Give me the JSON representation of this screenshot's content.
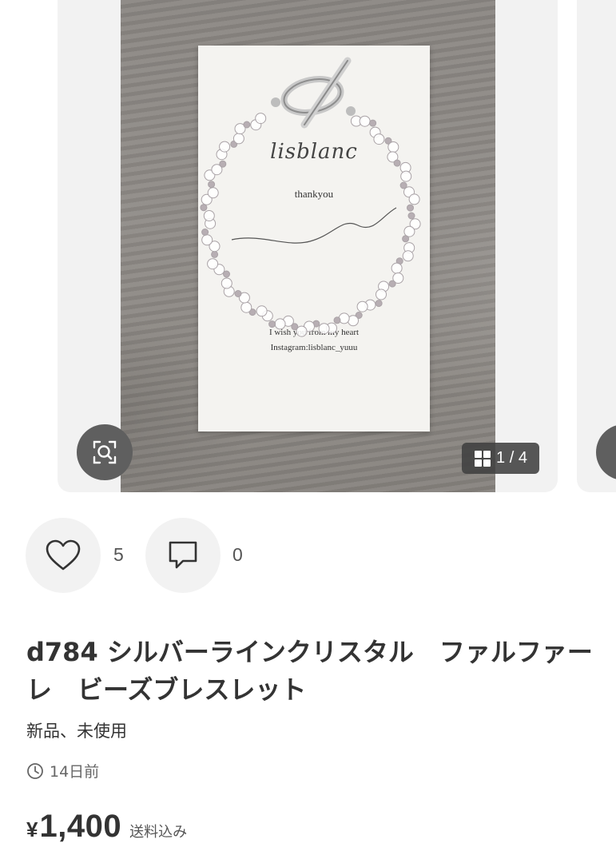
{
  "carousel": {
    "photo": {
      "card_brand": "lisblanc",
      "card_thankyou": "thankyou",
      "card_message": "I wish you     from my heart",
      "card_instagram": "Instagram:lisblanc_yuuu"
    },
    "zoom_icon": "zoom-search-icon",
    "counter": {
      "icon": "grid-icon",
      "text": "1 / 4"
    }
  },
  "actions": {
    "like": {
      "icon": "heart-icon",
      "count": "5"
    },
    "comment": {
      "icon": "comment-icon",
      "count": "0"
    }
  },
  "item": {
    "title": "d784 シルバーラインクリスタル　ファルファーレ　ビーズブレスレット",
    "condition": "新品、未使用",
    "posted_icon": "clock-icon",
    "posted": "14日前",
    "price": {
      "currency": "¥",
      "amount": "1,400",
      "shipping_note": "送料込み"
    }
  },
  "colors": {
    "text": "#333333",
    "button_bg": "#f2f2f2",
    "overlay": "#5f5f5f"
  }
}
